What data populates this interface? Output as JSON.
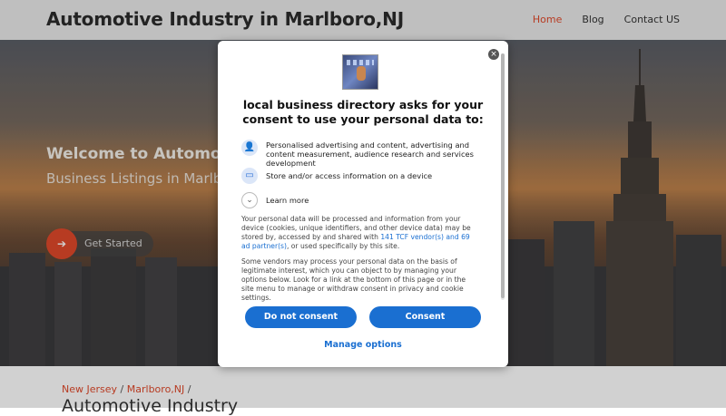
{
  "header": {
    "site_title": "Automotive Industry in Marlboro,NJ",
    "nav": [
      {
        "label": "Home",
        "active": true
      },
      {
        "label": "Blog",
        "active": false
      },
      {
        "label": "Contact US",
        "active": false
      }
    ]
  },
  "hero": {
    "title": "Welcome to Automotive",
    "subtitle": "Business Listings in Marlboro",
    "cta_label": "Get Started",
    "cta_icon": "arrow-right-icon"
  },
  "breadcrumb": {
    "items": [
      "New Jersey",
      "Marlboro,NJ"
    ],
    "separator": "/"
  },
  "page_heading": "Automotive Industry",
  "consent_modal": {
    "close_label": "×",
    "title": "local business directory asks for your consent to use your personal data to:",
    "purposes": [
      {
        "icon": "user-icon",
        "text": "Personalised advertising and content, advertising and content measurement, audience research and services development"
      },
      {
        "icon": "device-icon",
        "text": "Store and/or access information on a device"
      }
    ],
    "learn_more": "Learn more",
    "paragraph1_part1": "Your personal data will be processed and information from your device (cookies, unique identifiers, and other device data) may be stored by, accessed by and shared with ",
    "paragraph1_link": "141 TCF vendor(s) and 69 ad partner(s)",
    "paragraph1_part2": ", or used specifically by this site.",
    "paragraph2": "Some vendors may process your personal data on the basis of legitimate interest, which you can object to by managing your options below. Look for a link at the bottom of this page or in the site menu to manage or withdraw consent in privacy and cookie settings.",
    "buttons": {
      "do_not_consent": "Do not consent",
      "consent": "Consent"
    },
    "manage_options": "Manage options"
  },
  "colors": {
    "accent": "#e0492a",
    "consent_blue": "#1a6fd1"
  }
}
